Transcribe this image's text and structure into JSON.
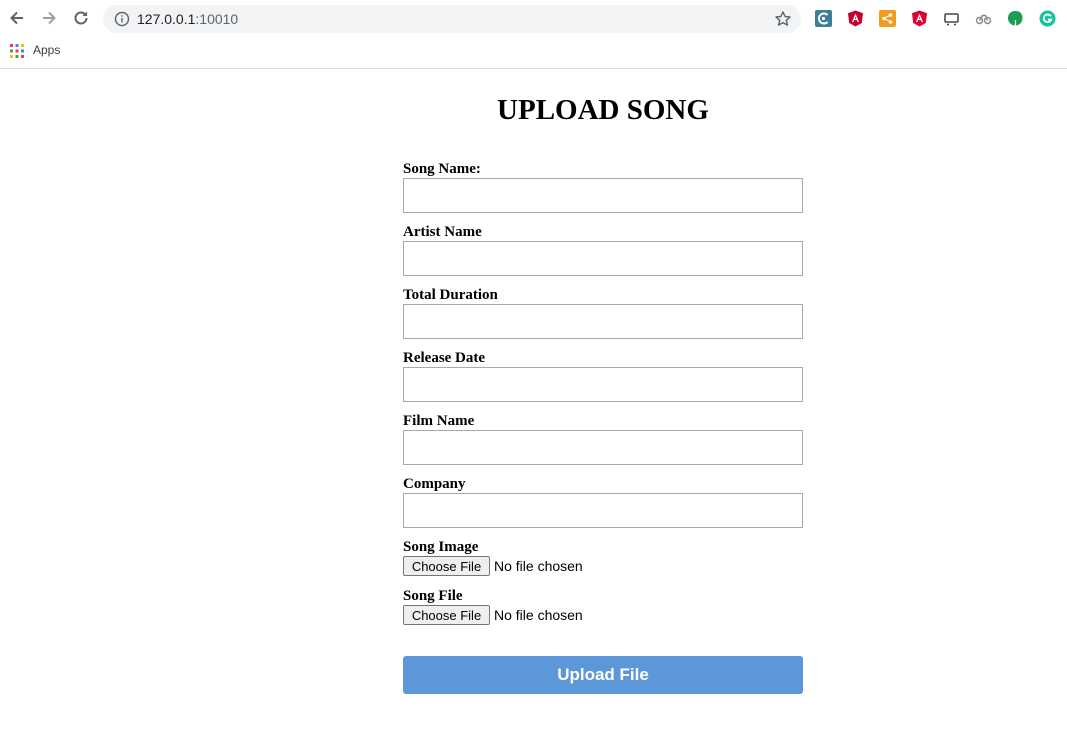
{
  "browser": {
    "url_host": "127.0.0.1",
    "url_port": ":10010",
    "bookmarks_apps_label": "Apps",
    "colors": {
      "omnibox_bg": "#f1f3f4",
      "accent_upload": "#5b97d9"
    },
    "extensions": [
      "chrome-ext-icon",
      "angular-icon",
      "share-icon",
      "angular-icon",
      "display-icon",
      "cycle-icon",
      "leaf-icon",
      "grammarly-icon"
    ]
  },
  "form": {
    "title": "UPLOAD SONG",
    "fields": [
      {
        "label": "Song Name:",
        "value": ""
      },
      {
        "label": "Artist Name",
        "value": ""
      },
      {
        "label": "Total Duration",
        "value": ""
      },
      {
        "label": "Release Date",
        "value": ""
      },
      {
        "label": "Film Name",
        "value": ""
      },
      {
        "label": "Company",
        "value": ""
      }
    ],
    "files": [
      {
        "label": "Song Image",
        "button": "Choose File",
        "status": "No file chosen"
      },
      {
        "label": "Song File",
        "button": "Choose File",
        "status": "No file chosen"
      }
    ],
    "submit_label": "Upload File"
  }
}
